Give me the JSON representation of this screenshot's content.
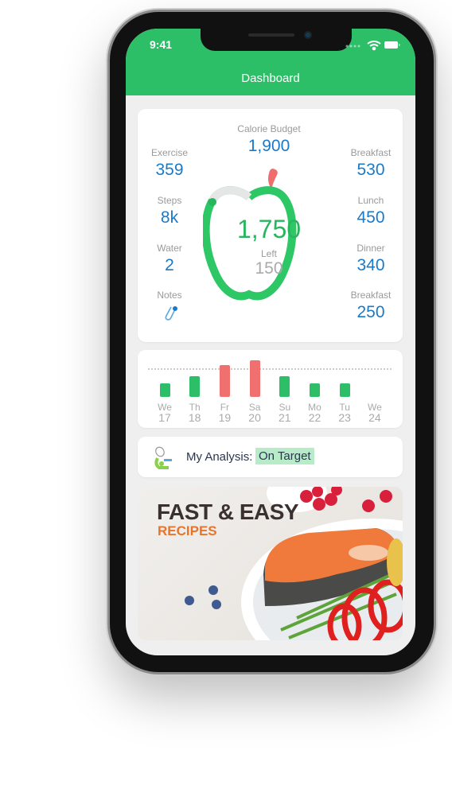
{
  "status_bar": {
    "time": "9:41",
    "icons": [
      "signal-icon",
      "wifi-icon",
      "battery-icon"
    ]
  },
  "header": {
    "title": "Dashboard"
  },
  "summary": {
    "calorie_budget": {
      "label": "Calorie Budget",
      "value": "1,900"
    },
    "consumed": "1,750",
    "left": {
      "label": "Left",
      "value": "150"
    },
    "progress": 0.92,
    "left_stats": [
      {
        "label": "Exercise",
        "value": "359"
      },
      {
        "label": "Steps",
        "value": "8k"
      },
      {
        "label": "Water",
        "value": "2"
      }
    ],
    "notes": {
      "label": "Notes",
      "icon": "paperclip-icon"
    },
    "right_stats": [
      {
        "label": "Breakfast",
        "value": "530"
      },
      {
        "label": "Lunch",
        "value": "450"
      },
      {
        "label": "Dinner",
        "value": "340"
      },
      {
        "label": "Breakfast",
        "value": "250"
      }
    ]
  },
  "chart_data": {
    "type": "bar",
    "categories": [
      "We 17",
      "Th 18",
      "Fr 19",
      "Sa 20",
      "Su 21",
      "Mo 22",
      "Tu 23",
      "We 24"
    ],
    "days": [
      "We",
      "Th",
      "Fr",
      "Sa",
      "Su",
      "Mo",
      "Tu",
      "We"
    ],
    "dates": [
      "17",
      "18",
      "19",
      "20",
      "21",
      "22",
      "23",
      "24"
    ],
    "values": [
      17,
      26,
      40,
      46,
      26,
      17,
      17,
      0
    ],
    "target": 35,
    "ylim": [
      0,
      50
    ],
    "colors": {
      "under": "#2dbe68",
      "over": "#f07070"
    }
  },
  "analysis": {
    "label": "My Analysis:",
    "status": "On Target",
    "icon": "microscope-icon"
  },
  "banner": {
    "title": "FAST & EASY",
    "subtitle": "RECIPES"
  },
  "colors": {
    "brand": "#2dbe68",
    "accent": "#1a7ac8",
    "highlight": "#b8ecc9",
    "orange": "#e8742a"
  }
}
